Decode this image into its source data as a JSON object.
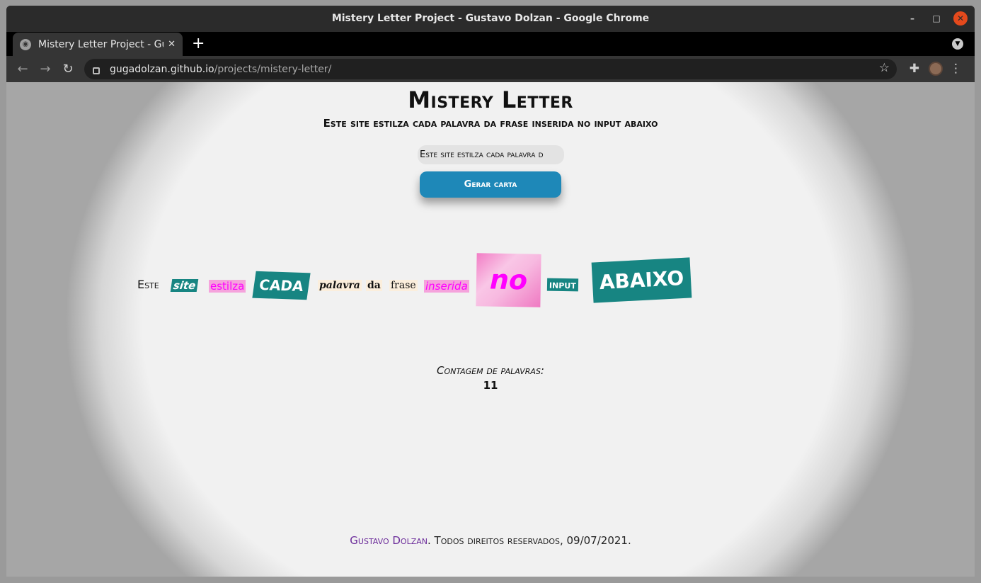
{
  "window": {
    "title": "Mistery Letter Project - Gustavo Dolzan - Google Chrome",
    "controls": {
      "minimize": "–",
      "maximize": "□",
      "close": "✕"
    }
  },
  "tabs": [
    {
      "title": "Mistery Letter Project - Gu",
      "close": "✕"
    }
  ],
  "toolbar": {
    "new_tab": "+",
    "url_host": "gugadolzan.github.io",
    "url_path": "/projects/mistery-letter/"
  },
  "icons": {
    "back": "arrow-left-icon",
    "forward": "arrow-right-icon",
    "reload": "reload-icon",
    "lock": "lock-icon",
    "bookmark": "star-icon",
    "extensions": "puzzle-icon",
    "menu": "kebab-menu-icon",
    "tab_favicon": "globe-icon"
  },
  "page": {
    "title": "Mistery Letter",
    "subtitle": "Este site estilza cada palavra da frase inserida no input abaixo",
    "input_value": "Este site estilza cada palavra d",
    "button_label": "Gerar carta",
    "letter_words": [
      "Este",
      "site",
      "estilza",
      "CADA",
      "palavra",
      "da",
      "frase",
      "inserida",
      "no",
      "input",
      "ABAIXO"
    ],
    "count_label": "Contagem de palavras:",
    "count_value": "11",
    "footer_author": "Gustavo Dolzan",
    "footer_text": ". Todos direitos reservados, 09/07/2021."
  },
  "colors": {
    "button": "#1e88b8",
    "teal_word": "#178582",
    "pink_text": "#ff00ff",
    "pink_bg": "#f5a3dc",
    "cream_bg": "#fbeedc",
    "footer_link": "#6b2b9a"
  }
}
